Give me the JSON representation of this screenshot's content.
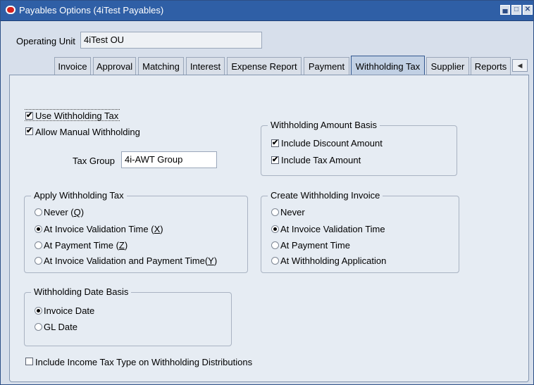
{
  "window": {
    "title": "Payables Options (4iTest Payables)"
  },
  "header": {
    "operating_unit_label": "Operating Unit",
    "operating_unit_value": "4iTest OU"
  },
  "tabs": [
    {
      "label": "Invoice"
    },
    {
      "label": "Approval"
    },
    {
      "label": "Matching"
    },
    {
      "label": "Interest"
    },
    {
      "label": "Expense Report"
    },
    {
      "label": "Payment"
    },
    {
      "label": "Withholding Tax"
    },
    {
      "label": "Supplier"
    },
    {
      "label": "Reports"
    }
  ],
  "active_tab": "Withholding Tax",
  "options": {
    "use_withholding_tax": {
      "label": "Use Withholding Tax",
      "checked": true
    },
    "allow_manual_withholding": {
      "label": "Allow Manual Withholding",
      "checked": true
    },
    "tax_group_label": "Tax Group",
    "tax_group_value": "4i-AWT Group",
    "include_income_tax_type": {
      "label": "Include Income Tax Type on Withholding Distributions",
      "checked": false
    }
  },
  "withholding_amount_basis": {
    "title": "Withholding Amount Basis",
    "include_discount": {
      "label": "Include Discount Amount",
      "checked": true
    },
    "include_tax": {
      "label": "Include Tax Amount",
      "checked": true
    }
  },
  "apply_withholding_tax": {
    "title": "Apply Withholding Tax",
    "never": {
      "text": "Never (",
      "key": "Q",
      "end": ")"
    },
    "validation": {
      "text": "At Invoice Validation Time (",
      "key": "X",
      "end": ")"
    },
    "payment": {
      "text": "At Payment Time (",
      "key": "Z",
      "end": ")"
    },
    "both": {
      "text": "At Invoice Validation and Payment Time(",
      "key": "Y",
      "end": ")"
    },
    "selected": "validation"
  },
  "create_withholding_invoice": {
    "title": "Create Withholding Invoice",
    "never": "Never",
    "validation": "At Invoice Validation Time",
    "payment": "At Payment Time",
    "application": "At Withholding Application",
    "selected": "validation"
  },
  "withholding_date_basis": {
    "title": "Withholding Date Basis",
    "invoice_date": "Invoice Date",
    "gl_date": "GL Date",
    "selected": "invoice_date"
  },
  "icons": {
    "app": "oracle-icon",
    "minimize": "minimize-icon",
    "maximize": "maximize-icon",
    "close": "close-icon",
    "tab_scroll": "triangle-left-icon"
  }
}
